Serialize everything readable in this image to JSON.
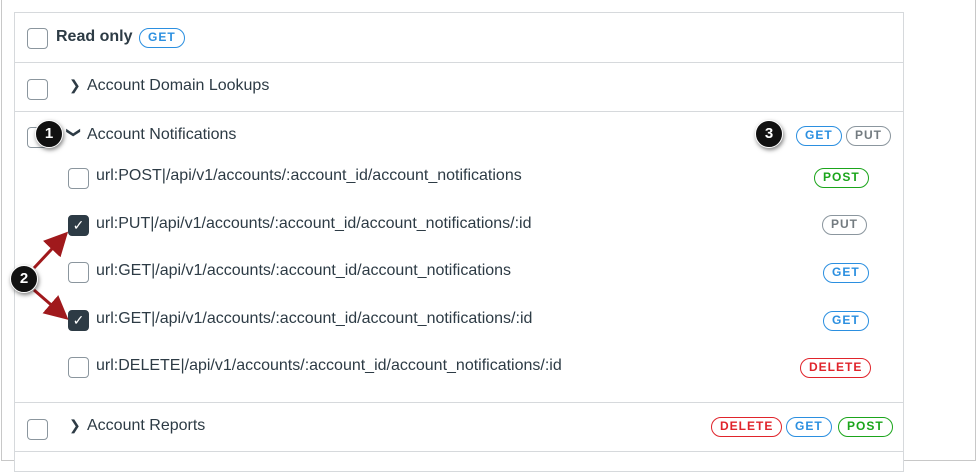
{
  "read_only": {
    "label": "Read only",
    "methods": [
      "GET"
    ]
  },
  "groups": [
    {
      "label": "Account Domain Lookups",
      "expanded": false
    },
    {
      "label": "Account Notifications",
      "expanded": true,
      "methods": [
        "GET",
        "PUT"
      ],
      "endpoints": [
        {
          "url": "url:POST|/api/v1/accounts/:account_id/account_notifications",
          "method": "POST",
          "checked": false
        },
        {
          "url": "url:PUT|/api/v1/accounts/:account_id/account_notifications/:id",
          "method": "PUT",
          "checked": true
        },
        {
          "url": "url:GET|/api/v1/accounts/:account_id/account_notifications",
          "method": "GET",
          "checked": false
        },
        {
          "url": "url:GET|/api/v1/accounts/:account_id/account_notifications/:id",
          "method": "GET",
          "checked": true
        },
        {
          "url": "url:DELETE|/api/v1/accounts/:account_id/account_notifications/:id",
          "method": "DELETE",
          "checked": false
        }
      ]
    },
    {
      "label": "Account Reports",
      "expanded": false,
      "methods": [
        "DELETE",
        "GET",
        "POST"
      ]
    }
  ],
  "callouts": [
    "1",
    "2",
    "3"
  ],
  "colors": {
    "get": "#2b8fe0",
    "put": "#737b80",
    "post": "#1ba51b",
    "delete": "#e0242b",
    "checked": "#2d3b45"
  }
}
